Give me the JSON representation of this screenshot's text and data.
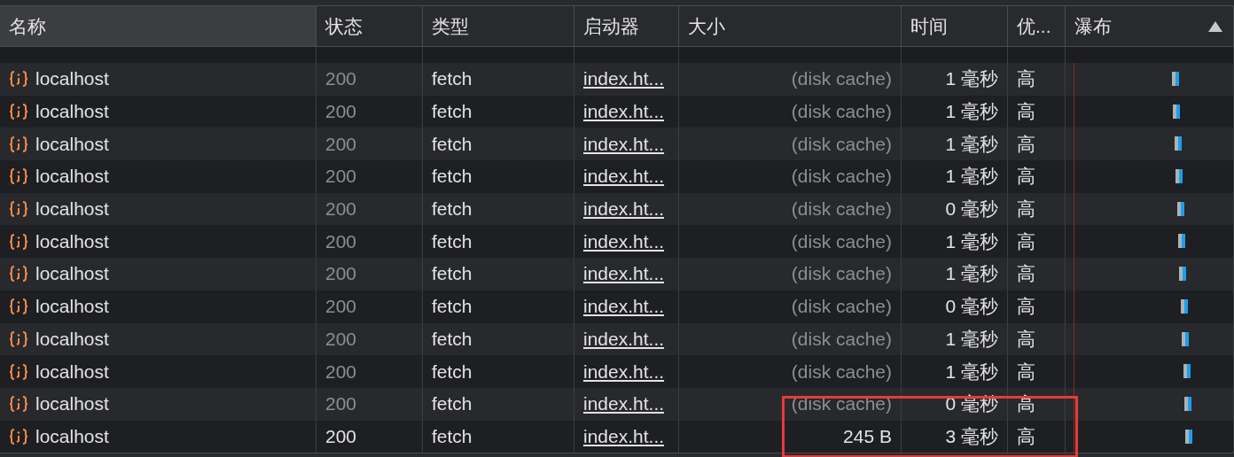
{
  "columns": [
    {
      "label": "名称",
      "selected": true
    },
    {
      "label": "状态",
      "selected": false
    },
    {
      "label": "类型",
      "selected": false
    },
    {
      "label": "启动器",
      "selected": false
    },
    {
      "label": "大小",
      "selected": false
    },
    {
      "label": "时间",
      "selected": false
    },
    {
      "label": "优...",
      "selected": false
    },
    {
      "label": "瀑布",
      "selected": false
    }
  ],
  "rows": [
    {
      "name": "localhost",
      "status": "200",
      "type": "fetch",
      "initiator": "index.ht...",
      "size": "(disk cache)",
      "time": "1 毫秒",
      "priority": "高",
      "cached": true
    },
    {
      "name": "localhost",
      "status": "200",
      "type": "fetch",
      "initiator": "index.ht...",
      "size": "(disk cache)",
      "time": "1 毫秒",
      "priority": "高",
      "cached": true
    },
    {
      "name": "localhost",
      "status": "200",
      "type": "fetch",
      "initiator": "index.ht...",
      "size": "(disk cache)",
      "time": "1 毫秒",
      "priority": "高",
      "cached": true
    },
    {
      "name": "localhost",
      "status": "200",
      "type": "fetch",
      "initiator": "index.ht...",
      "size": "(disk cache)",
      "time": "1 毫秒",
      "priority": "高",
      "cached": true
    },
    {
      "name": "localhost",
      "status": "200",
      "type": "fetch",
      "initiator": "index.ht...",
      "size": "(disk cache)",
      "time": "0 毫秒",
      "priority": "高",
      "cached": true
    },
    {
      "name": "localhost",
      "status": "200",
      "type": "fetch",
      "initiator": "index.ht...",
      "size": "(disk cache)",
      "time": "1 毫秒",
      "priority": "高",
      "cached": true
    },
    {
      "name": "localhost",
      "status": "200",
      "type": "fetch",
      "initiator": "index.ht...",
      "size": "(disk cache)",
      "time": "1 毫秒",
      "priority": "高",
      "cached": true
    },
    {
      "name": "localhost",
      "status": "200",
      "type": "fetch",
      "initiator": "index.ht...",
      "size": "(disk cache)",
      "time": "0 毫秒",
      "priority": "高",
      "cached": true
    },
    {
      "name": "localhost",
      "status": "200",
      "type": "fetch",
      "initiator": "index.ht...",
      "size": "(disk cache)",
      "time": "1 毫秒",
      "priority": "高",
      "cached": true
    },
    {
      "name": "localhost",
      "status": "200",
      "type": "fetch",
      "initiator": "index.ht...",
      "size": "(disk cache)",
      "time": "1 毫秒",
      "priority": "高",
      "cached": true
    },
    {
      "name": "localhost",
      "status": "200",
      "type": "fetch",
      "initiator": "index.ht...",
      "size": "(disk cache)",
      "time": "0 毫秒",
      "priority": "高",
      "cached": true
    },
    {
      "name": "localhost",
      "status": "200",
      "type": "fetch",
      "initiator": "index.ht...",
      "size": "245 B",
      "time": "3 毫秒",
      "priority": "高",
      "cached": false
    }
  ]
}
